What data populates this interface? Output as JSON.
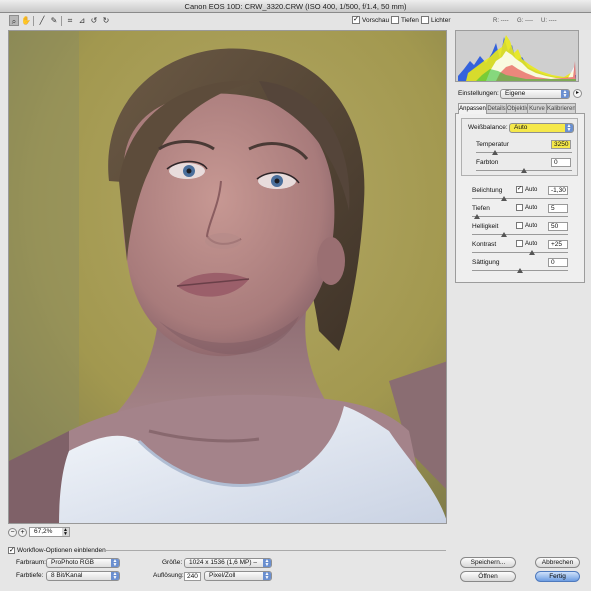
{
  "window": {
    "title": "Canon EOS 10D:  CRW_3320.CRW  (ISO 400, 1/500, f/1.4, 50 mm)"
  },
  "toolbar": {
    "tools": [
      {
        "name": "zoom-tool-icon",
        "glyph": "🔍"
      },
      {
        "name": "hand-tool-icon",
        "glyph": "✋"
      },
      {
        "name": "white-balance-tool-icon",
        "glyph": "⁄"
      },
      {
        "name": "color-sampler-tool-icon",
        "glyph": "✎"
      },
      {
        "name": "crop-tool-icon",
        "glyph": "⌗"
      },
      {
        "name": "straighten-tool-icon",
        "glyph": "⊿"
      },
      {
        "name": "rotate-left-icon",
        "glyph": "↺"
      },
      {
        "name": "rotate-right-icon",
        "glyph": "↻"
      }
    ],
    "preview_label": "Vorschau",
    "shadows_label": "Tiefen",
    "highlights_label": "Lichter",
    "rgb_r": "R: ----",
    "rgb_g": "G: ----",
    "rgb_b": "U: ----"
  },
  "preview": {
    "zoom_value": "67,2%"
  },
  "settings": {
    "label": "Einstellungen:",
    "value": "Eigene",
    "tabs": [
      "Anpassen",
      "Details",
      "Objektiv",
      "Kurve",
      "Kalibrieren"
    ],
    "active_tab": "Anpassen"
  },
  "white_balance": {
    "label": "Weißbalance:",
    "value": "Auto",
    "temperature_label": "Temperatur",
    "temperature_value": "3250",
    "temperature_pos": 0.2,
    "tint_label": "Farbton",
    "tint_value": "0",
    "tint_pos": 0.5
  },
  "adjustments": [
    {
      "label": "Belichtung",
      "auto_label": "Auto",
      "auto": true,
      "value": "-1,30",
      "pos": 0.33
    },
    {
      "label": "Tiefen",
      "auto_label": "Auto",
      "auto": false,
      "value": "5",
      "pos": 0.05
    },
    {
      "label": "Helligkeit",
      "auto_label": "Auto",
      "auto": false,
      "value": "50",
      "pos": 0.33
    },
    {
      "label": "Kontrast",
      "auto_label": "Auto",
      "auto": false,
      "value": "+25",
      "pos": 0.62
    },
    {
      "label": "Sättigung",
      "value": "0",
      "pos": 0.5
    }
  ],
  "workflow": {
    "toggle_label": "Workflow-Optionen einblenden",
    "colorspace_label": "Farbraum:",
    "colorspace_value": "ProPhoto RGB",
    "depth_label": "Farbtiefe:",
    "depth_value": "8 Bit/Kanal",
    "size_label": "Größe:",
    "size_value": "1024 x 1536 (1,6 MP)  –",
    "resolution_label": "Auflösung:",
    "resolution_value": "240",
    "resolution_unit": "Pixel/Zoll"
  },
  "buttons": {
    "save": "Speichern...",
    "cancel": "Abbrechen",
    "open": "Öffnen",
    "done": "Fertig"
  },
  "colors": {
    "accent": "#6a8fd0",
    "highlight": "#f5e84a",
    "wall": "#a69a55"
  }
}
